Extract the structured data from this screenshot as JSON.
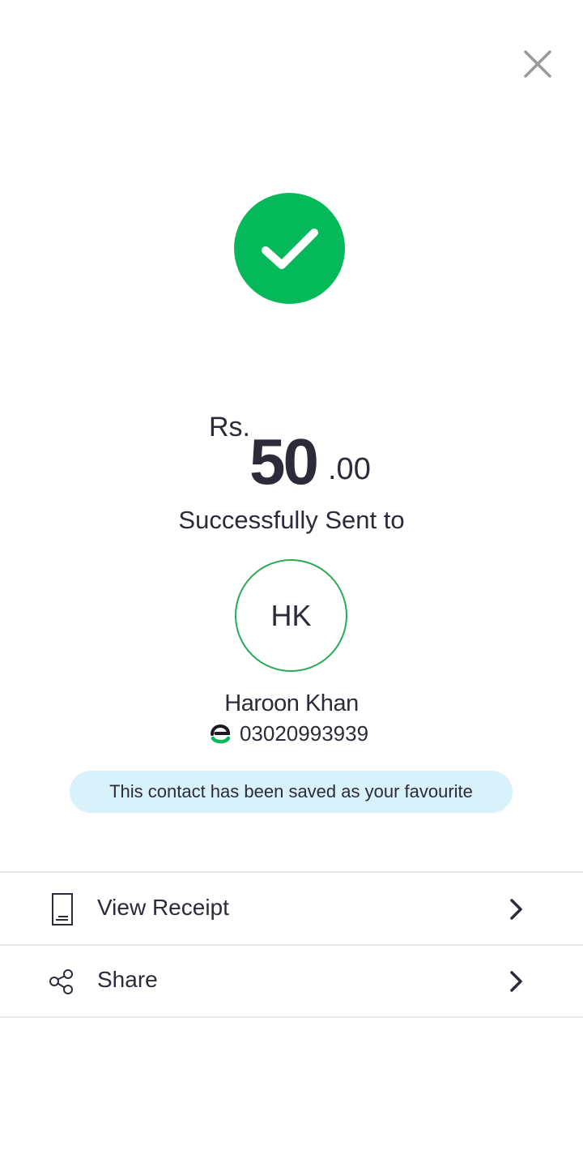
{
  "colors": {
    "success_green": "#03b95a",
    "avatar_border": "#2aa956",
    "banner_bg": "#d9f1fa",
    "text_primary": "#2b2b3a",
    "icon_grey": "#9a9a9a"
  },
  "header": {
    "close_icon": "close-icon"
  },
  "status": {
    "icon": "checkmark-icon"
  },
  "amount": {
    "currency": "Rs.",
    "whole": "50",
    "decimal": ".00"
  },
  "recipient": {
    "sent_to_label": "Successfully Sent to",
    "initials": "HK",
    "name": "Haroon Khan",
    "network_icon": "easypaisa-logo-icon",
    "number": "03020993939"
  },
  "favourite_banner": {
    "text": "This contact has been saved as your favourite"
  },
  "actions": [
    {
      "icon": "receipt-icon",
      "label": "View Receipt"
    },
    {
      "icon": "share-icon",
      "label": "Share"
    }
  ]
}
